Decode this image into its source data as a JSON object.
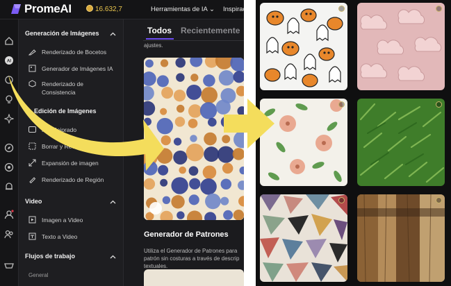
{
  "app": {
    "logo_text": "PromeAI",
    "credits": "16.632,7",
    "nav": [
      "Herramientas de IA",
      "Inspiración"
    ]
  },
  "rail_icons": [
    "home-icon",
    "ai-icon",
    "paint-icon",
    "lightbulb-icon",
    "compass-icon",
    "target-icon",
    "bell-icon",
    "user-icon",
    "community-icon",
    "basket-icon"
  ],
  "sidebar": {
    "sections": [
      {
        "title": "Generación de Imágenes",
        "items": [
          "Renderizado de Bocetos",
          "Generador de Imágenes IA",
          "Renderizado de Consistencia"
        ]
      },
      {
        "title": "Edición de Imágenes",
        "items": [
          "HD Mejorado",
          "Borrar y Reemplazar",
          "Expansión de imagen",
          "Renderizado de Región"
        ]
      },
      {
        "title": "Video",
        "items": [
          "Imagen a Video",
          "Texto a Video"
        ]
      },
      {
        "title": "Flujos de trabajo",
        "items": []
      }
    ],
    "general_label": "General"
  },
  "content": {
    "tabs": [
      "Todos",
      "Recientemente"
    ],
    "snippet": "ajustes.",
    "card_title": "Generador de Patrones",
    "card_desc": [
      "Utiliza el Generador de Patrones para",
      "patrón sin costuras a través de descrip",
      "textuales."
    ]
  },
  "gallery": {
    "tiles": [
      "halloween-pattern",
      "cloud-pattern",
      "floral-pattern",
      "grass-pattern",
      "mosaic-pattern",
      "wood-pattern"
    ]
  },
  "colors": {
    "accent": "#6c4cf2",
    "arrow": "#f4dd5c",
    "credits": "#e9c54d"
  }
}
